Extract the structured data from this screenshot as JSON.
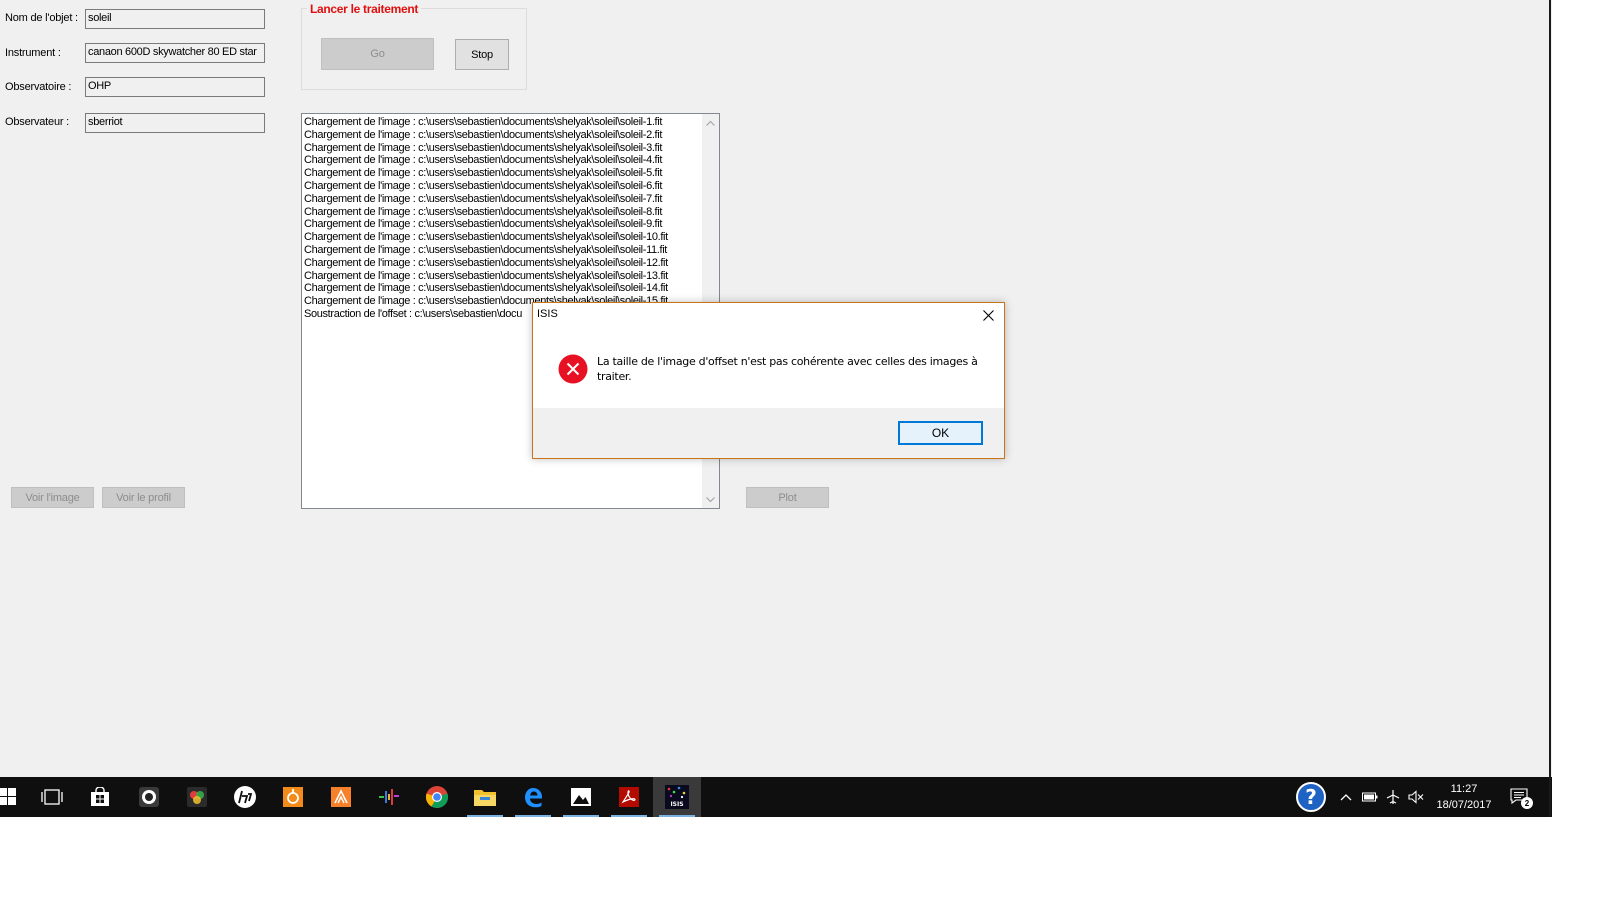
{
  "form": {
    "object_label": "Nom de l'objet :",
    "object_value": "soleil",
    "instrument_label": "Instrument :",
    "instrument_value": "canaon 600D skywatcher 80 ED star",
    "observatory_label": "Observatoire :",
    "observatory_value": "OHP",
    "observer_label": "Observateur :",
    "observer_value": "sberriot"
  },
  "processing": {
    "group_title": "Lancer le traitement",
    "go_label": "Go",
    "stop_label": "Stop"
  },
  "buttons": {
    "view_image": "Voir l'image",
    "view_profile": "Voir le profil",
    "plot": "Plot"
  },
  "log": {
    "lines": [
      "Chargement de l'image : c:\\users\\sebastien\\documents\\shelyak\\soleil\\soleil-1.fit",
      "Chargement de l'image : c:\\users\\sebastien\\documents\\shelyak\\soleil\\soleil-2.fit",
      "Chargement de l'image : c:\\users\\sebastien\\documents\\shelyak\\soleil\\soleil-3.fit",
      "Chargement de l'image : c:\\users\\sebastien\\documents\\shelyak\\soleil\\soleil-4.fit",
      "Chargement de l'image : c:\\users\\sebastien\\documents\\shelyak\\soleil\\soleil-5.fit",
      "Chargement de l'image : c:\\users\\sebastien\\documents\\shelyak\\soleil\\soleil-6.fit",
      "Chargement de l'image : c:\\users\\sebastien\\documents\\shelyak\\soleil\\soleil-7.fit",
      "Chargement de l'image : c:\\users\\sebastien\\documents\\shelyak\\soleil\\soleil-8.fit",
      "Chargement de l'image : c:\\users\\sebastien\\documents\\shelyak\\soleil\\soleil-9.fit",
      "Chargement de l'image : c:\\users\\sebastien\\documents\\shelyak\\soleil\\soleil-10.fit",
      "Chargement de l'image : c:\\users\\sebastien\\documents\\shelyak\\soleil\\soleil-11.fit",
      "Chargement de l'image : c:\\users\\sebastien\\documents\\shelyak\\soleil\\soleil-12.fit",
      "Chargement de l'image : c:\\users\\sebastien\\documents\\shelyak\\soleil\\soleil-13.fit",
      "Chargement de l'image : c:\\users\\sebastien\\documents\\shelyak\\soleil\\soleil-14.fit",
      "Chargement de l'image : c:\\users\\sebastien\\documents\\shelyak\\soleil\\soleil-15.fit",
      "Soustraction de l'offset : c:\\users\\sebastien\\docu"
    ]
  },
  "dialog": {
    "title": "ISIS",
    "icon": "error-icon",
    "message": "La taille de l'image d'offset n'est pas cohérente avec celles des images à traiter.",
    "ok_label": "OK"
  },
  "taskbar": {
    "apps": [
      {
        "name": "start-icon"
      },
      {
        "name": "task-view-icon"
      },
      {
        "name": "store-icon"
      },
      {
        "name": "camera-app-icon"
      },
      {
        "name": "photo-editor-icon"
      },
      {
        "name": "hp-icon"
      },
      {
        "name": "orange-app-icon"
      },
      {
        "name": "sublime-icon"
      },
      {
        "name": "spectrum-app-icon"
      },
      {
        "name": "chrome-icon"
      },
      {
        "name": "file-explorer-icon"
      },
      {
        "name": "edge-icon"
      },
      {
        "name": "photos-icon"
      },
      {
        "name": "acrobat-icon"
      },
      {
        "name": "isis-icon"
      }
    ],
    "isis_icon_text": "ISIS",
    "help_text": "?",
    "time": "11:27",
    "date": "18/07/2017",
    "notification_count": "2"
  },
  "colors": {
    "group_title": "#e01010",
    "window_bg": "#f0f0f0",
    "dialog_border": "#c9731a",
    "ok_border": "#0078d7",
    "taskbar_bg": "#0f0f0f",
    "error_red": "#e81123"
  }
}
